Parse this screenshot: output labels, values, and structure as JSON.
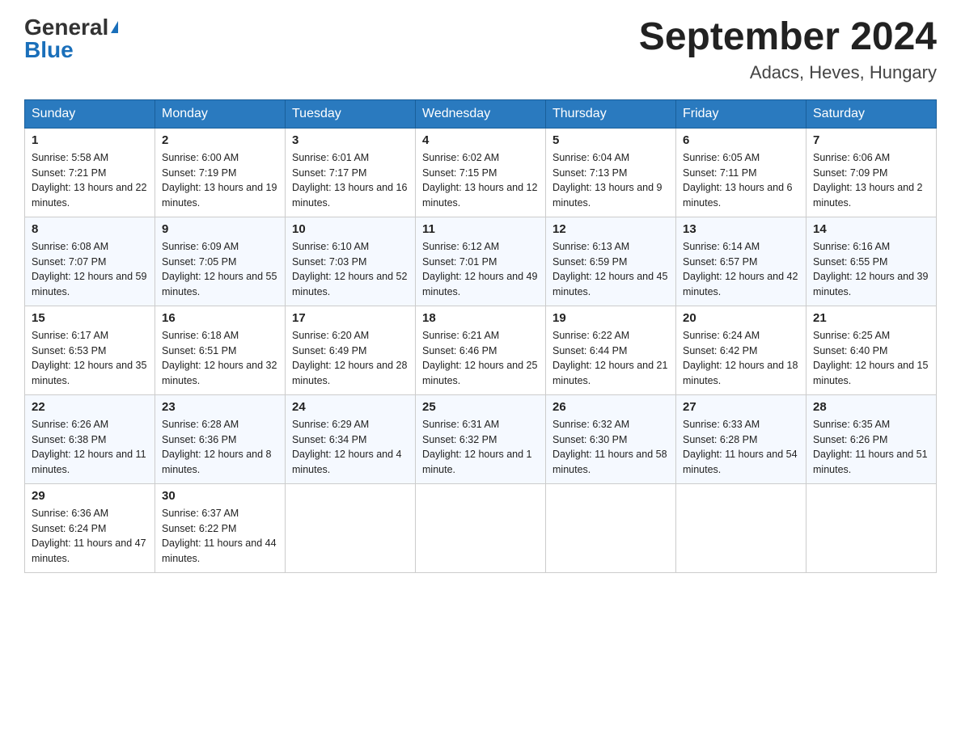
{
  "header": {
    "logo_general": "General",
    "logo_blue": "Blue",
    "month_title": "September 2024",
    "location": "Adacs, Heves, Hungary"
  },
  "days_of_week": [
    "Sunday",
    "Monday",
    "Tuesday",
    "Wednesday",
    "Thursday",
    "Friday",
    "Saturday"
  ],
  "weeks": [
    [
      {
        "day": "1",
        "sunrise": "5:58 AM",
        "sunset": "7:21 PM",
        "daylight": "13 hours and 22 minutes."
      },
      {
        "day": "2",
        "sunrise": "6:00 AM",
        "sunset": "7:19 PM",
        "daylight": "13 hours and 19 minutes."
      },
      {
        "day": "3",
        "sunrise": "6:01 AM",
        "sunset": "7:17 PM",
        "daylight": "13 hours and 16 minutes."
      },
      {
        "day": "4",
        "sunrise": "6:02 AM",
        "sunset": "7:15 PM",
        "daylight": "13 hours and 12 minutes."
      },
      {
        "day": "5",
        "sunrise": "6:04 AM",
        "sunset": "7:13 PM",
        "daylight": "13 hours and 9 minutes."
      },
      {
        "day": "6",
        "sunrise": "6:05 AM",
        "sunset": "7:11 PM",
        "daylight": "13 hours and 6 minutes."
      },
      {
        "day": "7",
        "sunrise": "6:06 AM",
        "sunset": "7:09 PM",
        "daylight": "13 hours and 2 minutes."
      }
    ],
    [
      {
        "day": "8",
        "sunrise": "6:08 AM",
        "sunset": "7:07 PM",
        "daylight": "12 hours and 59 minutes."
      },
      {
        "day": "9",
        "sunrise": "6:09 AM",
        "sunset": "7:05 PM",
        "daylight": "12 hours and 55 minutes."
      },
      {
        "day": "10",
        "sunrise": "6:10 AM",
        "sunset": "7:03 PM",
        "daylight": "12 hours and 52 minutes."
      },
      {
        "day": "11",
        "sunrise": "6:12 AM",
        "sunset": "7:01 PM",
        "daylight": "12 hours and 49 minutes."
      },
      {
        "day": "12",
        "sunrise": "6:13 AM",
        "sunset": "6:59 PM",
        "daylight": "12 hours and 45 minutes."
      },
      {
        "day": "13",
        "sunrise": "6:14 AM",
        "sunset": "6:57 PM",
        "daylight": "12 hours and 42 minutes."
      },
      {
        "day": "14",
        "sunrise": "6:16 AM",
        "sunset": "6:55 PM",
        "daylight": "12 hours and 39 minutes."
      }
    ],
    [
      {
        "day": "15",
        "sunrise": "6:17 AM",
        "sunset": "6:53 PM",
        "daylight": "12 hours and 35 minutes."
      },
      {
        "day": "16",
        "sunrise": "6:18 AM",
        "sunset": "6:51 PM",
        "daylight": "12 hours and 32 minutes."
      },
      {
        "day": "17",
        "sunrise": "6:20 AM",
        "sunset": "6:49 PM",
        "daylight": "12 hours and 28 minutes."
      },
      {
        "day": "18",
        "sunrise": "6:21 AM",
        "sunset": "6:46 PM",
        "daylight": "12 hours and 25 minutes."
      },
      {
        "day": "19",
        "sunrise": "6:22 AM",
        "sunset": "6:44 PM",
        "daylight": "12 hours and 21 minutes."
      },
      {
        "day": "20",
        "sunrise": "6:24 AM",
        "sunset": "6:42 PM",
        "daylight": "12 hours and 18 minutes."
      },
      {
        "day": "21",
        "sunrise": "6:25 AM",
        "sunset": "6:40 PM",
        "daylight": "12 hours and 15 minutes."
      }
    ],
    [
      {
        "day": "22",
        "sunrise": "6:26 AM",
        "sunset": "6:38 PM",
        "daylight": "12 hours and 11 minutes."
      },
      {
        "day": "23",
        "sunrise": "6:28 AM",
        "sunset": "6:36 PM",
        "daylight": "12 hours and 8 minutes."
      },
      {
        "day": "24",
        "sunrise": "6:29 AM",
        "sunset": "6:34 PM",
        "daylight": "12 hours and 4 minutes."
      },
      {
        "day": "25",
        "sunrise": "6:31 AM",
        "sunset": "6:32 PM",
        "daylight": "12 hours and 1 minute."
      },
      {
        "day": "26",
        "sunrise": "6:32 AM",
        "sunset": "6:30 PM",
        "daylight": "11 hours and 58 minutes."
      },
      {
        "day": "27",
        "sunrise": "6:33 AM",
        "sunset": "6:28 PM",
        "daylight": "11 hours and 54 minutes."
      },
      {
        "day": "28",
        "sunrise": "6:35 AM",
        "sunset": "6:26 PM",
        "daylight": "11 hours and 51 minutes."
      }
    ],
    [
      {
        "day": "29",
        "sunrise": "6:36 AM",
        "sunset": "6:24 PM",
        "daylight": "11 hours and 47 minutes."
      },
      {
        "day": "30",
        "sunrise": "6:37 AM",
        "sunset": "6:22 PM",
        "daylight": "11 hours and 44 minutes."
      },
      null,
      null,
      null,
      null,
      null
    ]
  ]
}
